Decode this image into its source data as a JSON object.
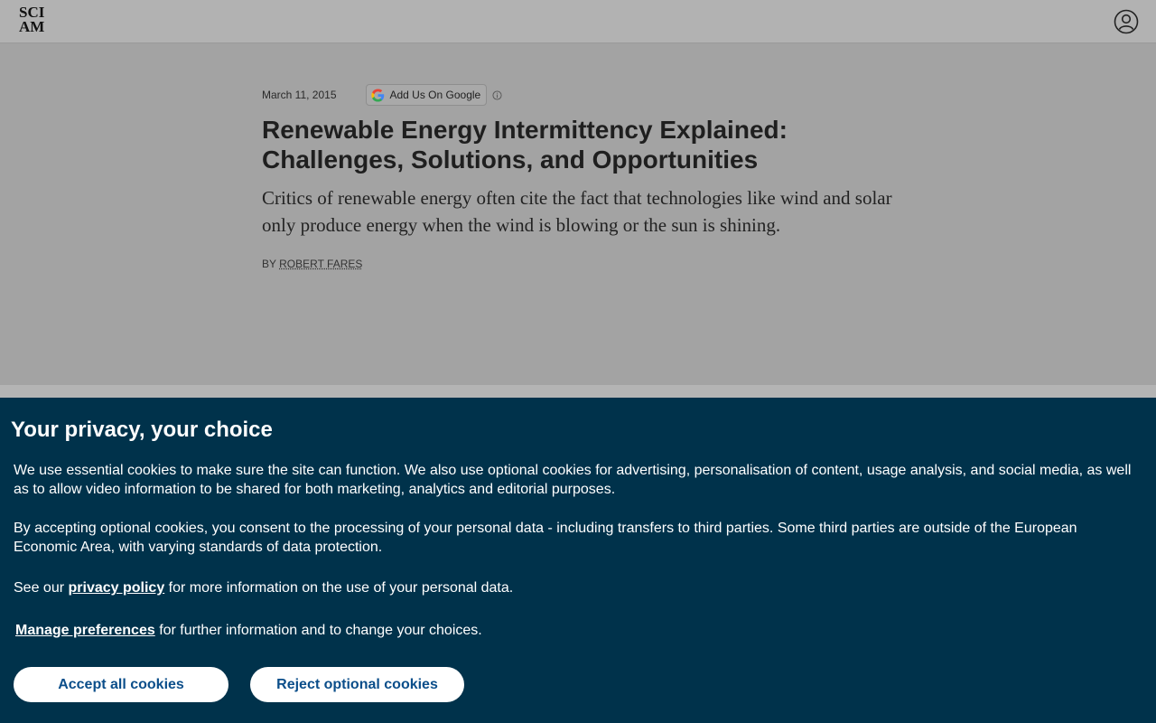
{
  "header": {
    "logo_line1": "SCI",
    "logo_line2": "AM",
    "account_icon": "user-circle-icon"
  },
  "article": {
    "date": "March 11, 2015",
    "google_button_label": "Add Us On Google",
    "title": "Renewable Energy Intermittency Explained: Challenges, Solutions, and Opportunities",
    "dek": "Critics of renewable energy often cite the fact that technologies like wind and solar only produce energy when the wind is blowing or the sun is shining.",
    "byline_prefix": "BY",
    "author": "ROBERT FARES"
  },
  "cookie_banner": {
    "title": "Your privacy, your choice",
    "paragraph1": "We use essential cookies to make sure the site can function. We also use optional cookies for advertising, personalisation of content, usage analysis, and social media, as well as to allow video information to be shared for both marketing, analytics and editorial purposes.",
    "paragraph2": "By accepting optional cookies, you consent to the processing of your personal data - including transfers to third parties. Some third parties are outside of the European Economic Area, with varying standards of data protection.",
    "p3_prefix": "See our",
    "privacy_link": "privacy policy",
    "p3_suffix": "for more information on the use of your personal data.",
    "manage_link": "Manage preferences",
    "p4_suffix": "for further information and to change your choices.",
    "accept_label": "Accept all cookies",
    "reject_label": "Reject optional cookies"
  },
  "colors": {
    "banner_bg": "#00324b",
    "button_text": "#0b4e8a",
    "overlay_bg": "#a3a3a3"
  }
}
